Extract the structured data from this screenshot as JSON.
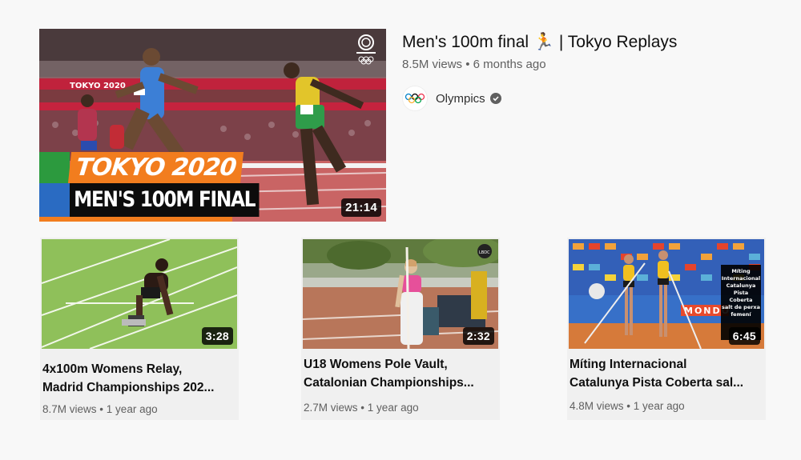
{
  "featured": {
    "title": "Men's 100m final 🏃 | Tokyo Replays",
    "views": "8.5M views",
    "age": "6 months ago",
    "channel": "Olympics",
    "channel_verified": true,
    "duration": "21:14",
    "overlay_line1": "TOKYO 2020",
    "overlay_line2": "MEN'S 100M FINAL",
    "banner_text": "TOKYO 2020",
    "accent_colors": [
      "#2c9a3e",
      "#f27d1e",
      "#2a6bc2"
    ]
  },
  "cards": [
    {
      "title_line1": "4x100m Womens Relay,",
      "title_line2": "Madrid Championships 202...",
      "views": "8.7M views",
      "age": "1 year ago",
      "duration": "3:28"
    },
    {
      "title_line1": "U18 Womens Pole Vault,",
      "title_line2": "Catalonian Championships...",
      "views": "2.7M views",
      "age": "1 year ago",
      "duration": "2:32"
    },
    {
      "title_line1": "Míting Internacional",
      "title_line2": "Catalunya Pista Coberta sal...",
      "views": "4.8M views",
      "age": "1 year ago",
      "duration": "6:45",
      "overlay_text": [
        "Míting",
        "Internacional",
        "Catalunya",
        "Pista",
        "Coberta",
        "salt de perxa",
        "femení"
      ],
      "banner_text": "MONDO"
    }
  ],
  "meta_separator": "•"
}
